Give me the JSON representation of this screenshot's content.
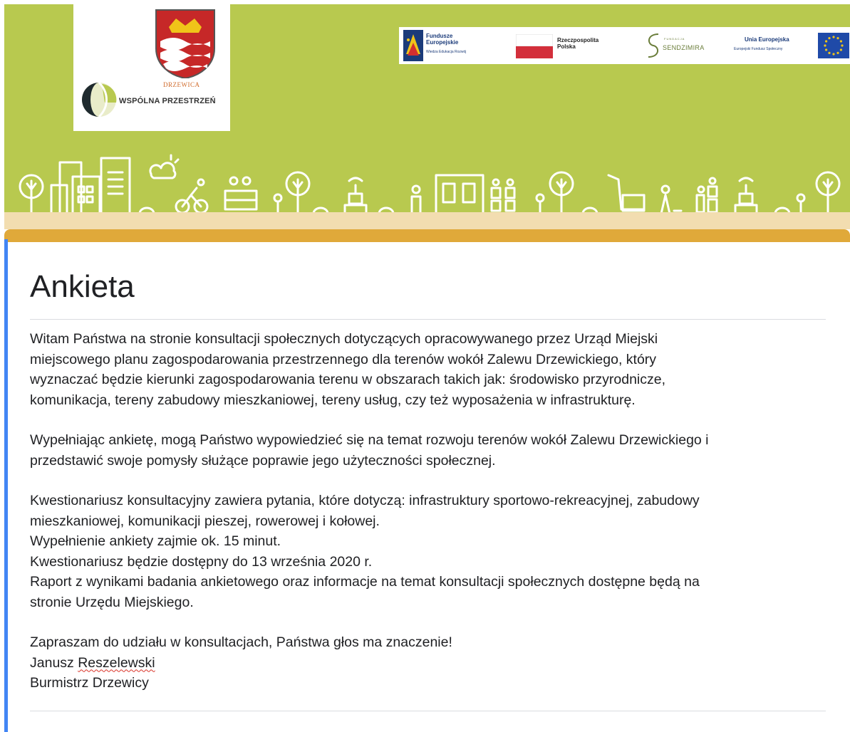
{
  "header": {
    "logo_town": "DRZEWICA",
    "logo_name": "WSPÓLNA PRZESTRZEŃ",
    "funding": {
      "fe_line1": "Fundusze",
      "fe_line2": "Europejskie",
      "fe_sub": "Wiedza Edukacja Rozwój",
      "rp_line1": "Rzeczpospolita",
      "rp_line2": "Polska",
      "sz_small": "FUNDACJA",
      "sz_label": "SENDZIMIRA",
      "ue_label": "Unia Europejska",
      "ue_sub": "Europejski Fundusz Społeczny"
    }
  },
  "form": {
    "title": "Ankieta",
    "intro": [
      "Witam Państwa na stronie konsultacji społecznych dotyczących opracowywanego przez Urząd Miejski",
      "miejscowego planu zagospodarowania przestrzennego dla terenów wokół Zalewu Drzewickiego, który",
      "wyznaczać będzie kierunki zagospodarowania terenu w obszarach takich jak: środowisko przyrodnicze,",
      "komunikacja, tereny zabudowy mieszkaniowej, tereny usług, czy też wyposażenia w infrastrukturę."
    ],
    "para2": [
      "Wypełniając ankietę, mogą Państwo wypowiedzieć się na temat rozwoju terenów wokół Zalewu Drzewickiego i",
      "przedstawić swoje pomysły służące poprawie jego użyteczności społecznej."
    ],
    "para3": [
      "Kwestionariusz konsultacyjny zawiera pytania, które dotyczą: infrastruktury sportowo-rekreacyjnej, zabudowy",
      "mieszkaniowej, komunikacji pieszej, rowerowej i kołowej.",
      "Wypełnienie ankiety zajmie ok. 15 minut.",
      "Kwestionariusz będzie dostępny do 13 września 2020 r.",
      "Raport z wynikami badania ankietowego oraz informacje na temat konsultacji społecznych dostępne będą na",
      "stronie Urzędu Miejskiego."
    ],
    "closing": "Zapraszam do udziału w konsultacjach, Państwa głos ma znaczenie!",
    "signature_first": "Janusz",
    "signature_last": "Reszelewski",
    "signature_role": "Burmistrz Drzewicy"
  },
  "colors": {
    "banner": "#b8c94f",
    "card_top": "#e0a93a",
    "card_accent": "#4285f4"
  }
}
